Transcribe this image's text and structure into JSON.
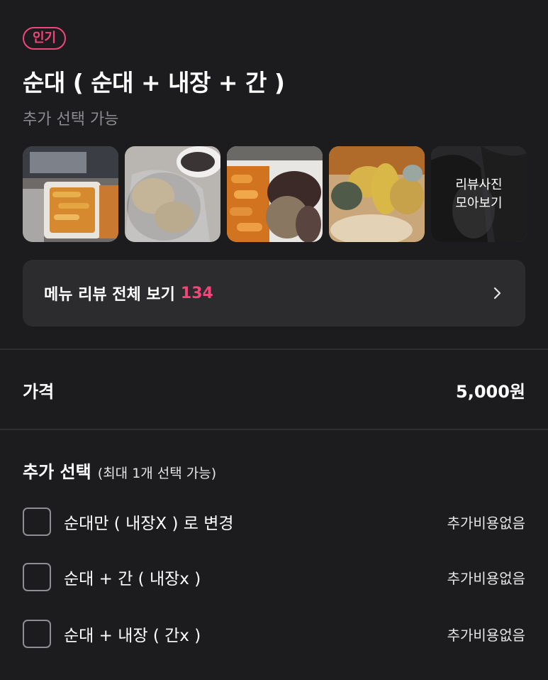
{
  "badge": "인기",
  "menu": {
    "title": "순대 ( 순대 + 내장 + 간 )",
    "subtitle": "추가 선택 가능"
  },
  "review_photos": {
    "more_label_line1": "리뷰사진",
    "more_label_line2": "모아보기"
  },
  "review_button": {
    "label": "메뉴 리뷰 전체 보기",
    "count": "134",
    "icon": "chevron-right-icon"
  },
  "price": {
    "label": "가격",
    "value": "5,000원"
  },
  "options": {
    "title": "추가 선택",
    "subtitle": "(최대 1개 선택 가능)",
    "items": [
      {
        "name": "순대만 ( 내장X ) 로 변경",
        "extra": "추가비용없음",
        "checked": false
      },
      {
        "name": "순대 + 간 ( 내장x )",
        "extra": "추가비용없음",
        "checked": false
      },
      {
        "name": "순대 + 내장 ( 간x )",
        "extra": "추가비용없음",
        "checked": false
      }
    ]
  },
  "colors": {
    "background": "#1c1c1e",
    "accent": "#f2467a",
    "card": "#2c2c2e",
    "muted_text": "#8c8c90"
  }
}
